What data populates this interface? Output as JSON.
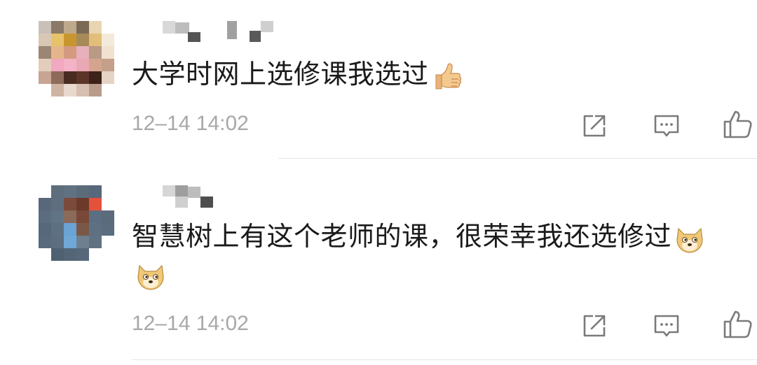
{
  "comments": [
    {
      "text": "大学时网上选修课我选过",
      "emoji": "thumbs-up",
      "timestamp": "12–14 14:02"
    },
    {
      "text": "智慧树上有这个老师的课，很荣幸我还选修过",
      "emoji": "doge",
      "emoji_trailing": "doge",
      "timestamp": "12–14 14:02"
    }
  ],
  "actions": [
    "share-icon",
    "reply-icon",
    "like-icon"
  ],
  "colors": {
    "text": "#1a1a1a",
    "meta": "#a8a8a8",
    "icon": "#7a7a7a",
    "divider": "#e6e6e6"
  }
}
